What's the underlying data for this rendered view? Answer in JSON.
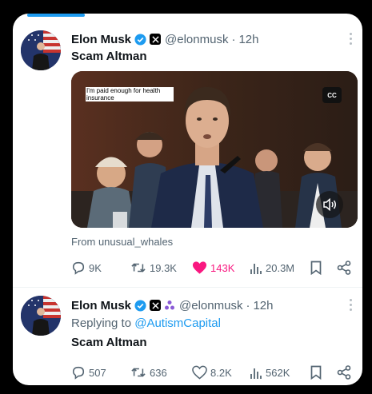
{
  "tweet1": {
    "name": "Elon Musk",
    "handle": "@elonmusk",
    "time": "12h",
    "text": "Scam Altman",
    "media": {
      "caption": "I'm paid enough for health insurance",
      "cc_label": "CC"
    },
    "source": "From unusual_whales",
    "replies": "9K",
    "reposts": "19.3K",
    "likes": "143K",
    "views": "20.3M"
  },
  "tweet2": {
    "name": "Elon Musk",
    "handle": "@elonmusk",
    "time": "12h",
    "reply_prefix": "Replying to ",
    "reply_to": "@AutismCapital",
    "text": "Scam Altman",
    "replies": "507",
    "reposts": "636",
    "likes": "8.2K",
    "views": "562K"
  },
  "colors": {
    "accent": "#1d9bf0",
    "like": "#f91880",
    "muted": "#536471"
  },
  "video_progress": 0.18
}
